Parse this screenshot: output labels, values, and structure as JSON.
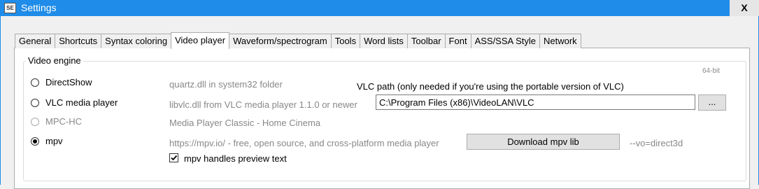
{
  "window": {
    "title": "Settings",
    "icon_text": "SE",
    "close_label": "X"
  },
  "tabs": [
    {
      "label": "General"
    },
    {
      "label": "Shortcuts"
    },
    {
      "label": "Syntax coloring"
    },
    {
      "label": "Video player",
      "active": true
    },
    {
      "label": "Waveform/spectrogram"
    },
    {
      "label": "Tools"
    },
    {
      "label": "Word lists"
    },
    {
      "label": "Toolbar"
    },
    {
      "label": "Font"
    },
    {
      "label": "ASS/SSA Style"
    },
    {
      "label": "Network"
    }
  ],
  "video_engine": {
    "legend": "Video engine",
    "bitness": "64-bit",
    "options": [
      {
        "label": "DirectShow",
        "description": "quartz.dll in system32 folder",
        "selected": false,
        "enabled": true
      },
      {
        "label": "VLC media player",
        "description": "libvlc.dll from VLC media player 1.1.0 or newer",
        "selected": false,
        "enabled": true
      },
      {
        "label": "MPC-HC",
        "description": "Media Player Classic - Home Cinema",
        "selected": false,
        "enabled": false
      },
      {
        "label": "mpv",
        "description": "https://mpv.io/ - free, open source, and cross-platform media player",
        "selected": true,
        "enabled": true
      }
    ],
    "vlc_path_label": "VLC path (only needed if you're using the portable version of VLC)",
    "vlc_path_value": "C:\\Program Files (x86)\\VideoLAN\\VLC",
    "browse_label": "...",
    "download_mpv_label": "Download mpv lib",
    "mpv_vo": "--vo=direct3d",
    "mpv_preview_label": "mpv handles preview text",
    "mpv_preview_checked": true
  }
}
